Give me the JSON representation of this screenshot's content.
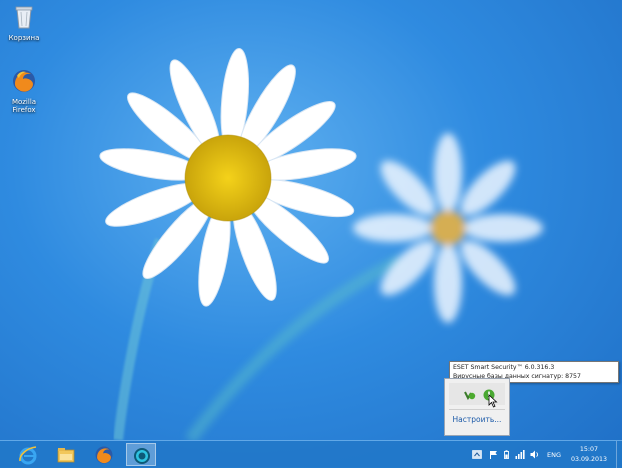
{
  "desktop": {
    "icons": [
      {
        "label": "Корзина",
        "icon": "recycle-bin-icon"
      },
      {
        "label": "Mozilla Firefox",
        "icon": "firefox-icon"
      }
    ]
  },
  "tooltip": {
    "line1": "ESET Smart Security™ 6.0.316.3",
    "line2": "Вирусные базы данных сигнатур: 8757 (20130903)"
  },
  "tray_flyout": {
    "icons": [
      "eset-shield-icon",
      "eset-update-icon"
    ],
    "customize_label": "Настроить..."
  },
  "taskbar": {
    "pinned": [
      "internet-explorer-icon",
      "file-explorer-icon",
      "firefox-icon",
      "eset-smart-security-icon"
    ],
    "active_app": "eset-smart-security-icon",
    "tray": {
      "lang": "ENG",
      "time": "15:07",
      "date": "03.09.2013"
    }
  },
  "colors": {
    "wallpaper": "#2f8be0",
    "taskbar": "#2178c8",
    "link": "#1c5aa8"
  }
}
